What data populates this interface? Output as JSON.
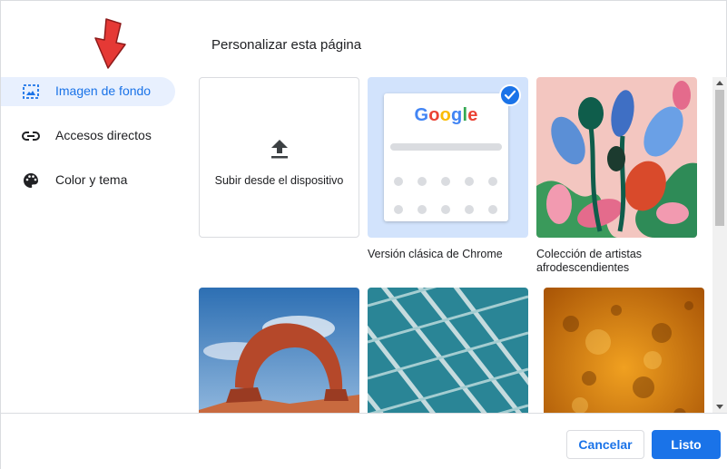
{
  "dialog": {
    "title": "Personalizar esta página"
  },
  "sidebar": {
    "items": [
      {
        "label": "Imagen de fondo",
        "icon": "image-icon",
        "active": true
      },
      {
        "label": "Accesos directos",
        "icon": "link-icon",
        "active": false
      },
      {
        "label": "Color y tema",
        "icon": "palette-icon",
        "active": false
      }
    ]
  },
  "backgrounds": {
    "upload_label": "Subir desde el dispositivo",
    "classic": {
      "caption": "Versión clásica de Chrome",
      "logo_text": "Google",
      "selected": true
    },
    "collections": [
      {
        "caption": "Colección de artistas afrodescendientes",
        "image": "abstract-floral-illustration"
      },
      {
        "caption": "",
        "image": "desert-rock-arch-photo"
      },
      {
        "caption": "",
        "image": "teal-geometric-architecture-photo"
      },
      {
        "caption": "",
        "image": "orange-texture-photo"
      }
    ]
  },
  "footer": {
    "cancel_label": "Cancelar",
    "done_label": "Listo"
  },
  "colors": {
    "accent": "#1a73e8",
    "active_bg": "#e8f0fe",
    "annotation_arrow": "#e53935"
  }
}
